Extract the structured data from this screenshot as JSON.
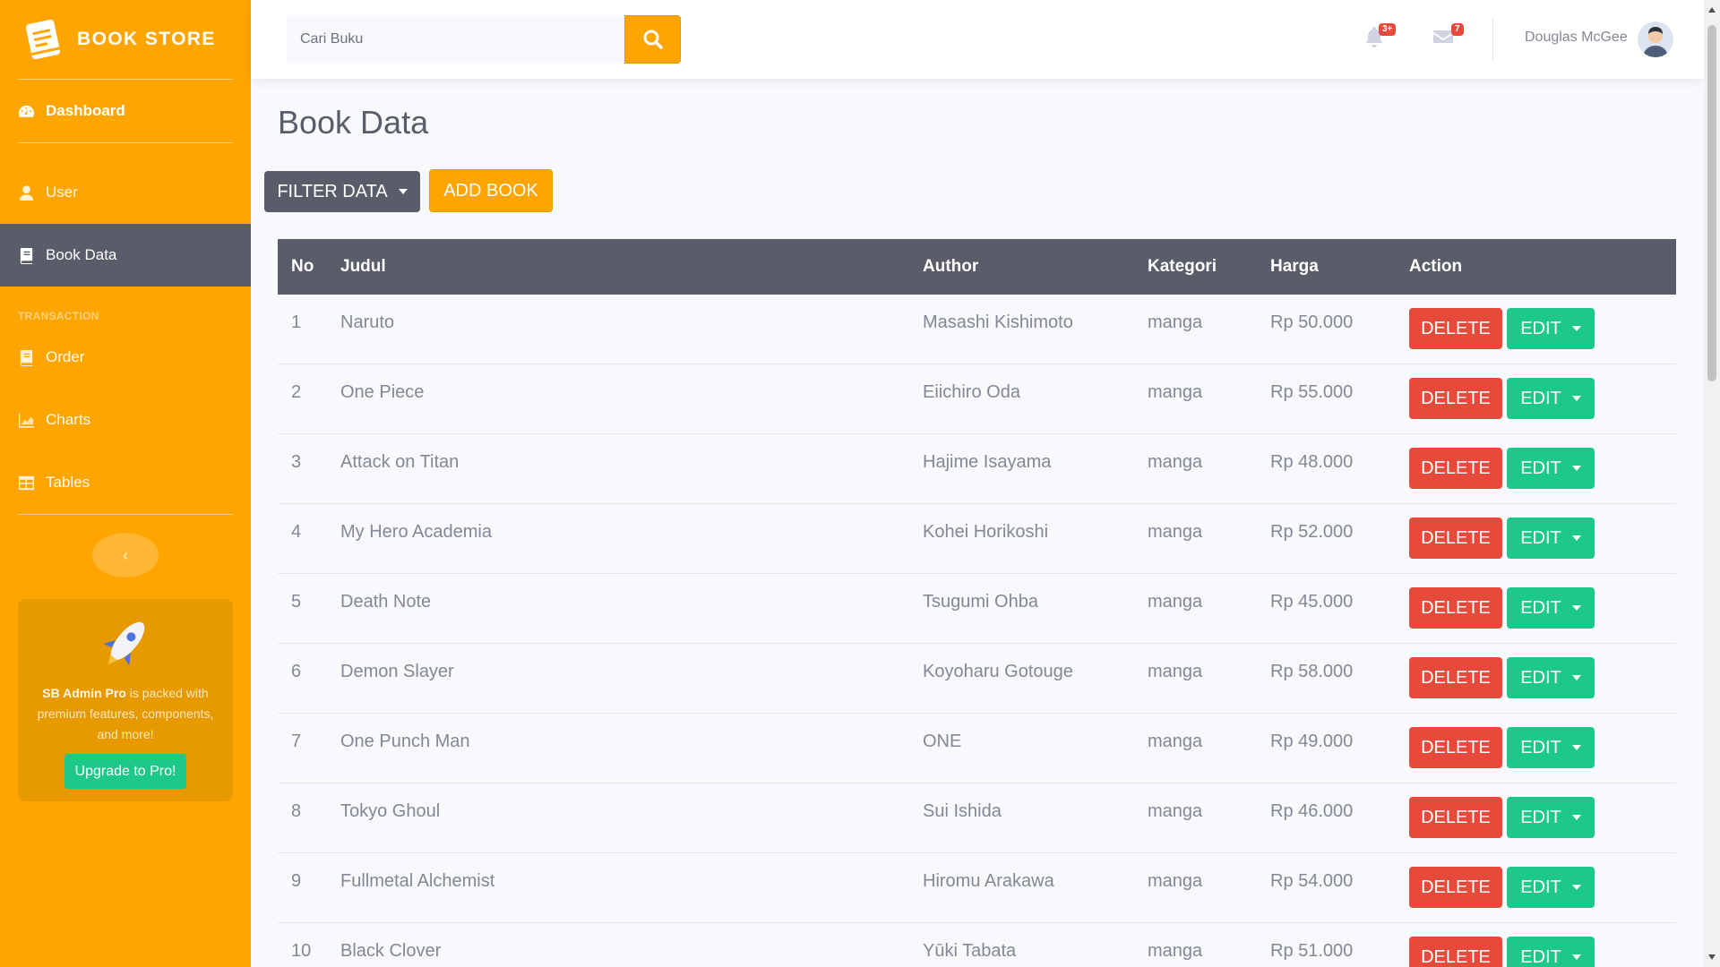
{
  "brand": {
    "name": "BOOK STORE"
  },
  "sidebar": {
    "items": [
      {
        "label": "Dashboard",
        "icon": "tachometer-icon"
      },
      {
        "label": "User",
        "icon": "user-icon"
      },
      {
        "label": "Book Data",
        "icon": "book-icon"
      },
      {
        "label": "Order",
        "icon": "book-icon"
      },
      {
        "label": "Charts",
        "icon": "chart-area-icon"
      },
      {
        "label": "Tables",
        "icon": "table-icon"
      }
    ],
    "heading_transaction": "TRANSACTION",
    "toggle_label": "‹"
  },
  "promo": {
    "strong": "SB Admin Pro",
    "text": " is packed with premium features, components, and more!",
    "button": "Upgrade to Pro!"
  },
  "topbar": {
    "search_placeholder": "Cari Buku",
    "alerts_badge": "3+",
    "messages_badge": "7",
    "user_name": "Douglas McGee"
  },
  "page": {
    "title": "Book Data",
    "filter_button": "FILTER DATA",
    "add_button": "ADD BOOK"
  },
  "table": {
    "headers": [
      "No",
      "Judul",
      "Author",
      "Kategori",
      "Harga",
      "Action"
    ],
    "delete_label": "DELETE",
    "edit_label": "EDIT",
    "rows": [
      {
        "no": "1",
        "judul": "Naruto",
        "author": "Masashi Kishimoto",
        "kategori": "manga",
        "harga": "Rp 50.000"
      },
      {
        "no": "2",
        "judul": "One Piece",
        "author": "Eiichiro Oda",
        "kategori": "manga",
        "harga": "Rp 55.000"
      },
      {
        "no": "3",
        "judul": "Attack on Titan",
        "author": "Hajime Isayama",
        "kategori": "manga",
        "harga": "Rp 48.000"
      },
      {
        "no": "4",
        "judul": "My Hero Academia",
        "author": "Kohei Horikoshi",
        "kategori": "manga",
        "harga": "Rp 52.000"
      },
      {
        "no": "5",
        "judul": "Death Note",
        "author": "Tsugumi Ohba",
        "kategori": "manga",
        "harga": "Rp 45.000"
      },
      {
        "no": "6",
        "judul": "Demon Slayer",
        "author": "Koyoharu Gotouge",
        "kategori": "manga",
        "harga": "Rp 58.000"
      },
      {
        "no": "7",
        "judul": "One Punch Man",
        "author": "ONE",
        "kategori": "manga",
        "harga": "Rp 49.000"
      },
      {
        "no": "8",
        "judul": "Tokyo Ghoul",
        "author": "Sui Ishida",
        "kategori": "manga",
        "harga": "Rp 46.000"
      },
      {
        "no": "9",
        "judul": "Fullmetal Alchemist",
        "author": "Hiromu Arakawa",
        "kategori": "manga",
        "harga": "Rp 54.000"
      },
      {
        "no": "10",
        "judul": "Black Clover",
        "author": "Yūki Tabata",
        "kategori": "manga",
        "harga": "Rp 51.000"
      }
    ]
  },
  "colors": {
    "primary": "#ffa500",
    "dark": "#5a5c69",
    "danger": "#e74a3b",
    "success": "#1cc88a"
  }
}
